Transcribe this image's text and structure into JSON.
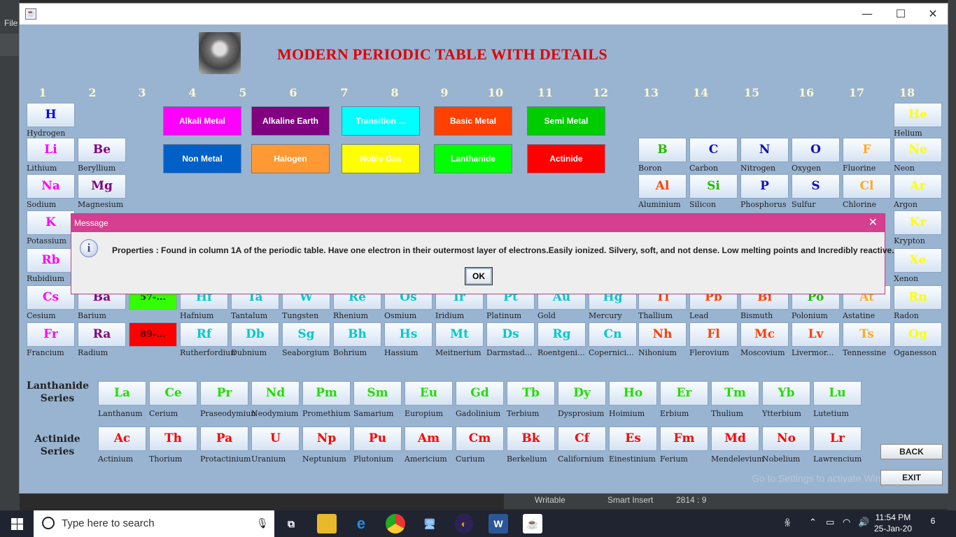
{
  "ide": {
    "menu_file": "File",
    "status": {
      "writable": "Writable",
      "insert": "Smart Insert",
      "position": "2814 : 9"
    }
  },
  "window": {
    "title_icon": "java-app-icon",
    "minimize": "—",
    "maximize": "☐",
    "close": "✕"
  },
  "title": "MODERN PERIODIC TABLE WITH DETAILS",
  "groups": [
    "1",
    "2",
    "3",
    "4",
    "5",
    "6",
    "7",
    "8",
    "9",
    "10",
    "11",
    "12",
    "13",
    "14",
    "15",
    "16",
    "17",
    "18"
  ],
  "legend": [
    {
      "label": "Alkali Metal",
      "bg": "#ff00ff",
      "fg": "#ffffff"
    },
    {
      "label": "Alkaline Earth",
      "bg": "#800080",
      "fg": "#ffffff"
    },
    {
      "label": "Transition ...",
      "bg": "#00ffff",
      "fg": "#ffffff"
    },
    {
      "label": "Basic Metal",
      "bg": "#ff4000",
      "fg": "#ffffff"
    },
    {
      "label": "Semi Metal",
      "bg": "#00cc00",
      "fg": "#ffffff"
    },
    {
      "label": "Non Metal",
      "bg": "#0060c8",
      "fg": "#ffffff"
    },
    {
      "label": "Halogen",
      "bg": "#ff9933",
      "fg": "#ffffff"
    },
    {
      "label": "Noble Gas",
      "bg": "#ffff00",
      "fg": "#ffffff"
    },
    {
      "label": "Lanthanide",
      "bg": "#00ff00",
      "fg": "#ffffff"
    },
    {
      "label": "Actinide",
      "bg": "#ff0000",
      "fg": "#ffffff"
    }
  ],
  "colors": {
    "alkali": "#ff00ff",
    "alkaline": "#800080",
    "transition": "#00c8c8",
    "basic": "#ff4000",
    "semi": "#22bb00",
    "nonmetal": "#1010c0",
    "halogen": "#ffaa22",
    "noble": "#ffff00",
    "hydrogen": "#0000ff",
    "lanthanide": "#22dd00",
    "actinide": "#ff0000"
  },
  "elements": [
    {
      "s": "H",
      "n": "Hydrogen",
      "c": "hydrogen"
    },
    {
      "s": "He",
      "n": "Helium",
      "c": "noble"
    },
    {
      "s": "Li",
      "n": "Lithium",
      "c": "alkali"
    },
    {
      "s": "Be",
      "n": "Beryllium",
      "c": "alkaline"
    },
    {
      "s": "B",
      "n": "Boron",
      "c": "semi"
    },
    {
      "s": "C",
      "n": "Carbon",
      "c": "nonmetal"
    },
    {
      "s": "N",
      "n": "Nitrogen",
      "c": "nonmetal"
    },
    {
      "s": "O",
      "n": "Oxygen",
      "c": "nonmetal"
    },
    {
      "s": "F",
      "n": "Fluorine",
      "c": "halogen"
    },
    {
      "s": "Ne",
      "n": "Neon",
      "c": "noble"
    },
    {
      "s": "Na",
      "n": "Sodium",
      "c": "alkali"
    },
    {
      "s": "Mg",
      "n": "Magnesium",
      "c": "alkaline"
    },
    {
      "s": "Al",
      "n": "Aluminium",
      "c": "basic"
    },
    {
      "s": "Si",
      "n": "Silicon",
      "c": "semi"
    },
    {
      "s": "P",
      "n": "Phosphorus",
      "c": "nonmetal"
    },
    {
      "s": "S",
      "n": "Sulfur",
      "c": "nonmetal"
    },
    {
      "s": "Cl",
      "n": "Chlorine",
      "c": "halogen"
    },
    {
      "s": "Ar",
      "n": "Argon",
      "c": "noble"
    },
    {
      "s": "K",
      "n": "Potassium",
      "c": "alkali"
    },
    {
      "s": "Kr",
      "n": "Krypton",
      "c": "noble"
    },
    {
      "s": "Rb",
      "n": "Rubidium",
      "c": "alkali"
    },
    {
      "s": "Xe",
      "n": "Xenon",
      "c": "noble"
    },
    {
      "s": "Cs",
      "n": "Cesium",
      "c": "alkali"
    },
    {
      "s": "Ba",
      "n": "Barium",
      "c": "alkaline"
    },
    {
      "s": "57-...",
      "n": "",
      "c": "lanthanide"
    },
    {
      "s": "Hf",
      "n": "Hafnium",
      "c": "transition"
    },
    {
      "s": "Ta",
      "n": "Tantalum",
      "c": "transition"
    },
    {
      "s": "W",
      "n": "Tungsten",
      "c": "transition"
    },
    {
      "s": "Re",
      "n": "Rhenium",
      "c": "transition"
    },
    {
      "s": "Os",
      "n": "Osmium",
      "c": "transition"
    },
    {
      "s": "Ir",
      "n": "Iridium",
      "c": "transition"
    },
    {
      "s": "Pt",
      "n": "Platinum",
      "c": "transition"
    },
    {
      "s": "Au",
      "n": "Gold",
      "c": "transition"
    },
    {
      "s": "Hg",
      "n": "Mercury",
      "c": "transition"
    },
    {
      "s": "Tl",
      "n": "Thallium",
      "c": "basic"
    },
    {
      "s": "Pb",
      "n": "Lead",
      "c": "basic"
    },
    {
      "s": "Bi",
      "n": "Bismuth",
      "c": "basic"
    },
    {
      "s": "Po",
      "n": "Polonium",
      "c": "semi"
    },
    {
      "s": "At",
      "n": "Astatine",
      "c": "halogen"
    },
    {
      "s": "Rn",
      "n": "Radon",
      "c": "noble"
    },
    {
      "s": "Fr",
      "n": "Francium",
      "c": "alkali"
    },
    {
      "s": "Ra",
      "n": "Radium",
      "c": "alkaline"
    },
    {
      "s": "89-...",
      "n": "",
      "c": "actinide"
    },
    {
      "s": "Rf",
      "n": "Rutherfordium",
      "c": "transition"
    },
    {
      "s": "Db",
      "n": "Dubnium",
      "c": "transition"
    },
    {
      "s": "Sg",
      "n": "Seaborgium",
      "c": "transition"
    },
    {
      "s": "Bh",
      "n": "Bohrium",
      "c": "transition"
    },
    {
      "s": "Hs",
      "n": "Hassium",
      "c": "transition"
    },
    {
      "s": "Mt",
      "n": "Meitnerium",
      "c": "transition"
    },
    {
      "s": "Ds",
      "n": "Darmstad...",
      "c": "transition"
    },
    {
      "s": "Rg",
      "n": "Roentgeni...",
      "c": "transition"
    },
    {
      "s": "Cn",
      "n": "Copernici...",
      "c": "transition"
    },
    {
      "s": "Nh",
      "n": "Nihonium",
      "c": "basic"
    },
    {
      "s": "Fl",
      "n": "Flerovium",
      "c": "basic"
    },
    {
      "s": "Mc",
      "n": "Moscovium",
      "c": "basic"
    },
    {
      "s": "Lv",
      "n": "Livermor...",
      "c": "basic"
    },
    {
      "s": "Ts",
      "n": "Tennessine",
      "c": "halogen"
    },
    {
      "s": "Og",
      "n": "Oganesson",
      "c": "noble"
    }
  ],
  "lanthanide_label": "Lanthanide Series",
  "actinide_label": "Actinide Series",
  "lanthanides": [
    {
      "s": "La",
      "n": "Lanthanum"
    },
    {
      "s": "Ce",
      "n": "Cerium"
    },
    {
      "s": "Pr",
      "n": "Praseodymium"
    },
    {
      "s": "Nd",
      "n": "Neodymium"
    },
    {
      "s": "Pm",
      "n": "Promethium"
    },
    {
      "s": "Sm",
      "n": "Samarium"
    },
    {
      "s": "Eu",
      "n": "Europium"
    },
    {
      "s": "Gd",
      "n": "Gadolinium"
    },
    {
      "s": "Tb",
      "n": "Terbium"
    },
    {
      "s": "Dy",
      "n": "Dysprosium"
    },
    {
      "s": "Ho",
      "n": "Hoimium"
    },
    {
      "s": "Er",
      "n": "Erbium"
    },
    {
      "s": "Tm",
      "n": "Thulium"
    },
    {
      "s": "Yb",
      "n": "Ytterbium"
    },
    {
      "s": "Lu",
      "n": "Lutetium"
    }
  ],
  "actinides": [
    {
      "s": "Ac",
      "n": "Actinium"
    },
    {
      "s": "Th",
      "n": "Thorium"
    },
    {
      "s": "Pa",
      "n": "Protactinium"
    },
    {
      "s": "U",
      "n": "Uranium"
    },
    {
      "s": "Np",
      "n": "Neptunium"
    },
    {
      "s": "Pu",
      "n": "Plutonium"
    },
    {
      "s": "Am",
      "n": "Americium"
    },
    {
      "s": "Cm",
      "n": "Curium"
    },
    {
      "s": "Bk",
      "n": "Berkelium"
    },
    {
      "s": "Cf",
      "n": "Californium"
    },
    {
      "s": "Es",
      "n": "Einestinium"
    },
    {
      "s": "Fm",
      "n": "Ferium"
    },
    {
      "s": "Md",
      "n": "Mendelevium"
    },
    {
      "s": "No",
      "n": "Nobelium"
    },
    {
      "s": "Lr",
      "n": "Lawrencium"
    }
  ],
  "buttons": {
    "back": "BACK",
    "exit": "EXIT"
  },
  "watermark": "Go to Settings to activate Windows.",
  "dialog": {
    "title": "Message",
    "close": "✕",
    "icon": "i",
    "message": "Properties : Found in column 1A of the periodic table. Have one electron in their outermost layer of electrons.Easily ionized. Silvery, soft, and not dense. Low melting points and Incredibly reactive.",
    "ok": "OK"
  },
  "taskbar": {
    "search_placeholder": "Type here to search",
    "time": "11:54 PM",
    "date": "25-Jan-20",
    "notifications": "6"
  }
}
